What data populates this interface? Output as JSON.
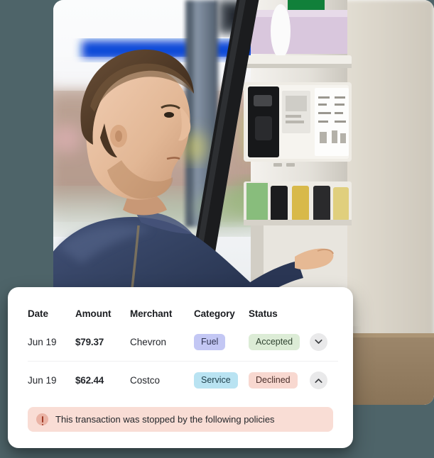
{
  "background": {
    "color": "#4e6469"
  },
  "photo": {
    "alt_description": "Man in navy jacket at a gas station fuel pump, reaching toward the pump keypad; cardboard box at lower right",
    "accent_sign_color": "#1148d8",
    "pump_panel_color": "#e7e4dd",
    "jacket_color": "#2e3f5c"
  },
  "card": {
    "table": {
      "columns": [
        "Date",
        "Amount",
        "Merchant",
        "Category",
        "Status"
      ],
      "rows": [
        {
          "date": "Jun 19",
          "amount": "$79.37",
          "merchant": "Chevron",
          "category": "Fuel",
          "category_color": "#c3c7f4",
          "status": "Accepted",
          "status_color": "#dcecd6",
          "action_icon": "chevron-down-icon"
        },
        {
          "date": "Jun 19",
          "amount": "$62.44",
          "merchant": "Costco",
          "category": "Service",
          "category_color": "#b9e3f2",
          "status": "Declined",
          "status_color": "#f8d8d0",
          "action_icon": "chevron-up-icon"
        }
      ]
    },
    "alert": {
      "icon": "alert-exclamation-icon",
      "message": "This transaction was stopped by the following policies",
      "background_color": "#f9ddd5"
    }
  }
}
